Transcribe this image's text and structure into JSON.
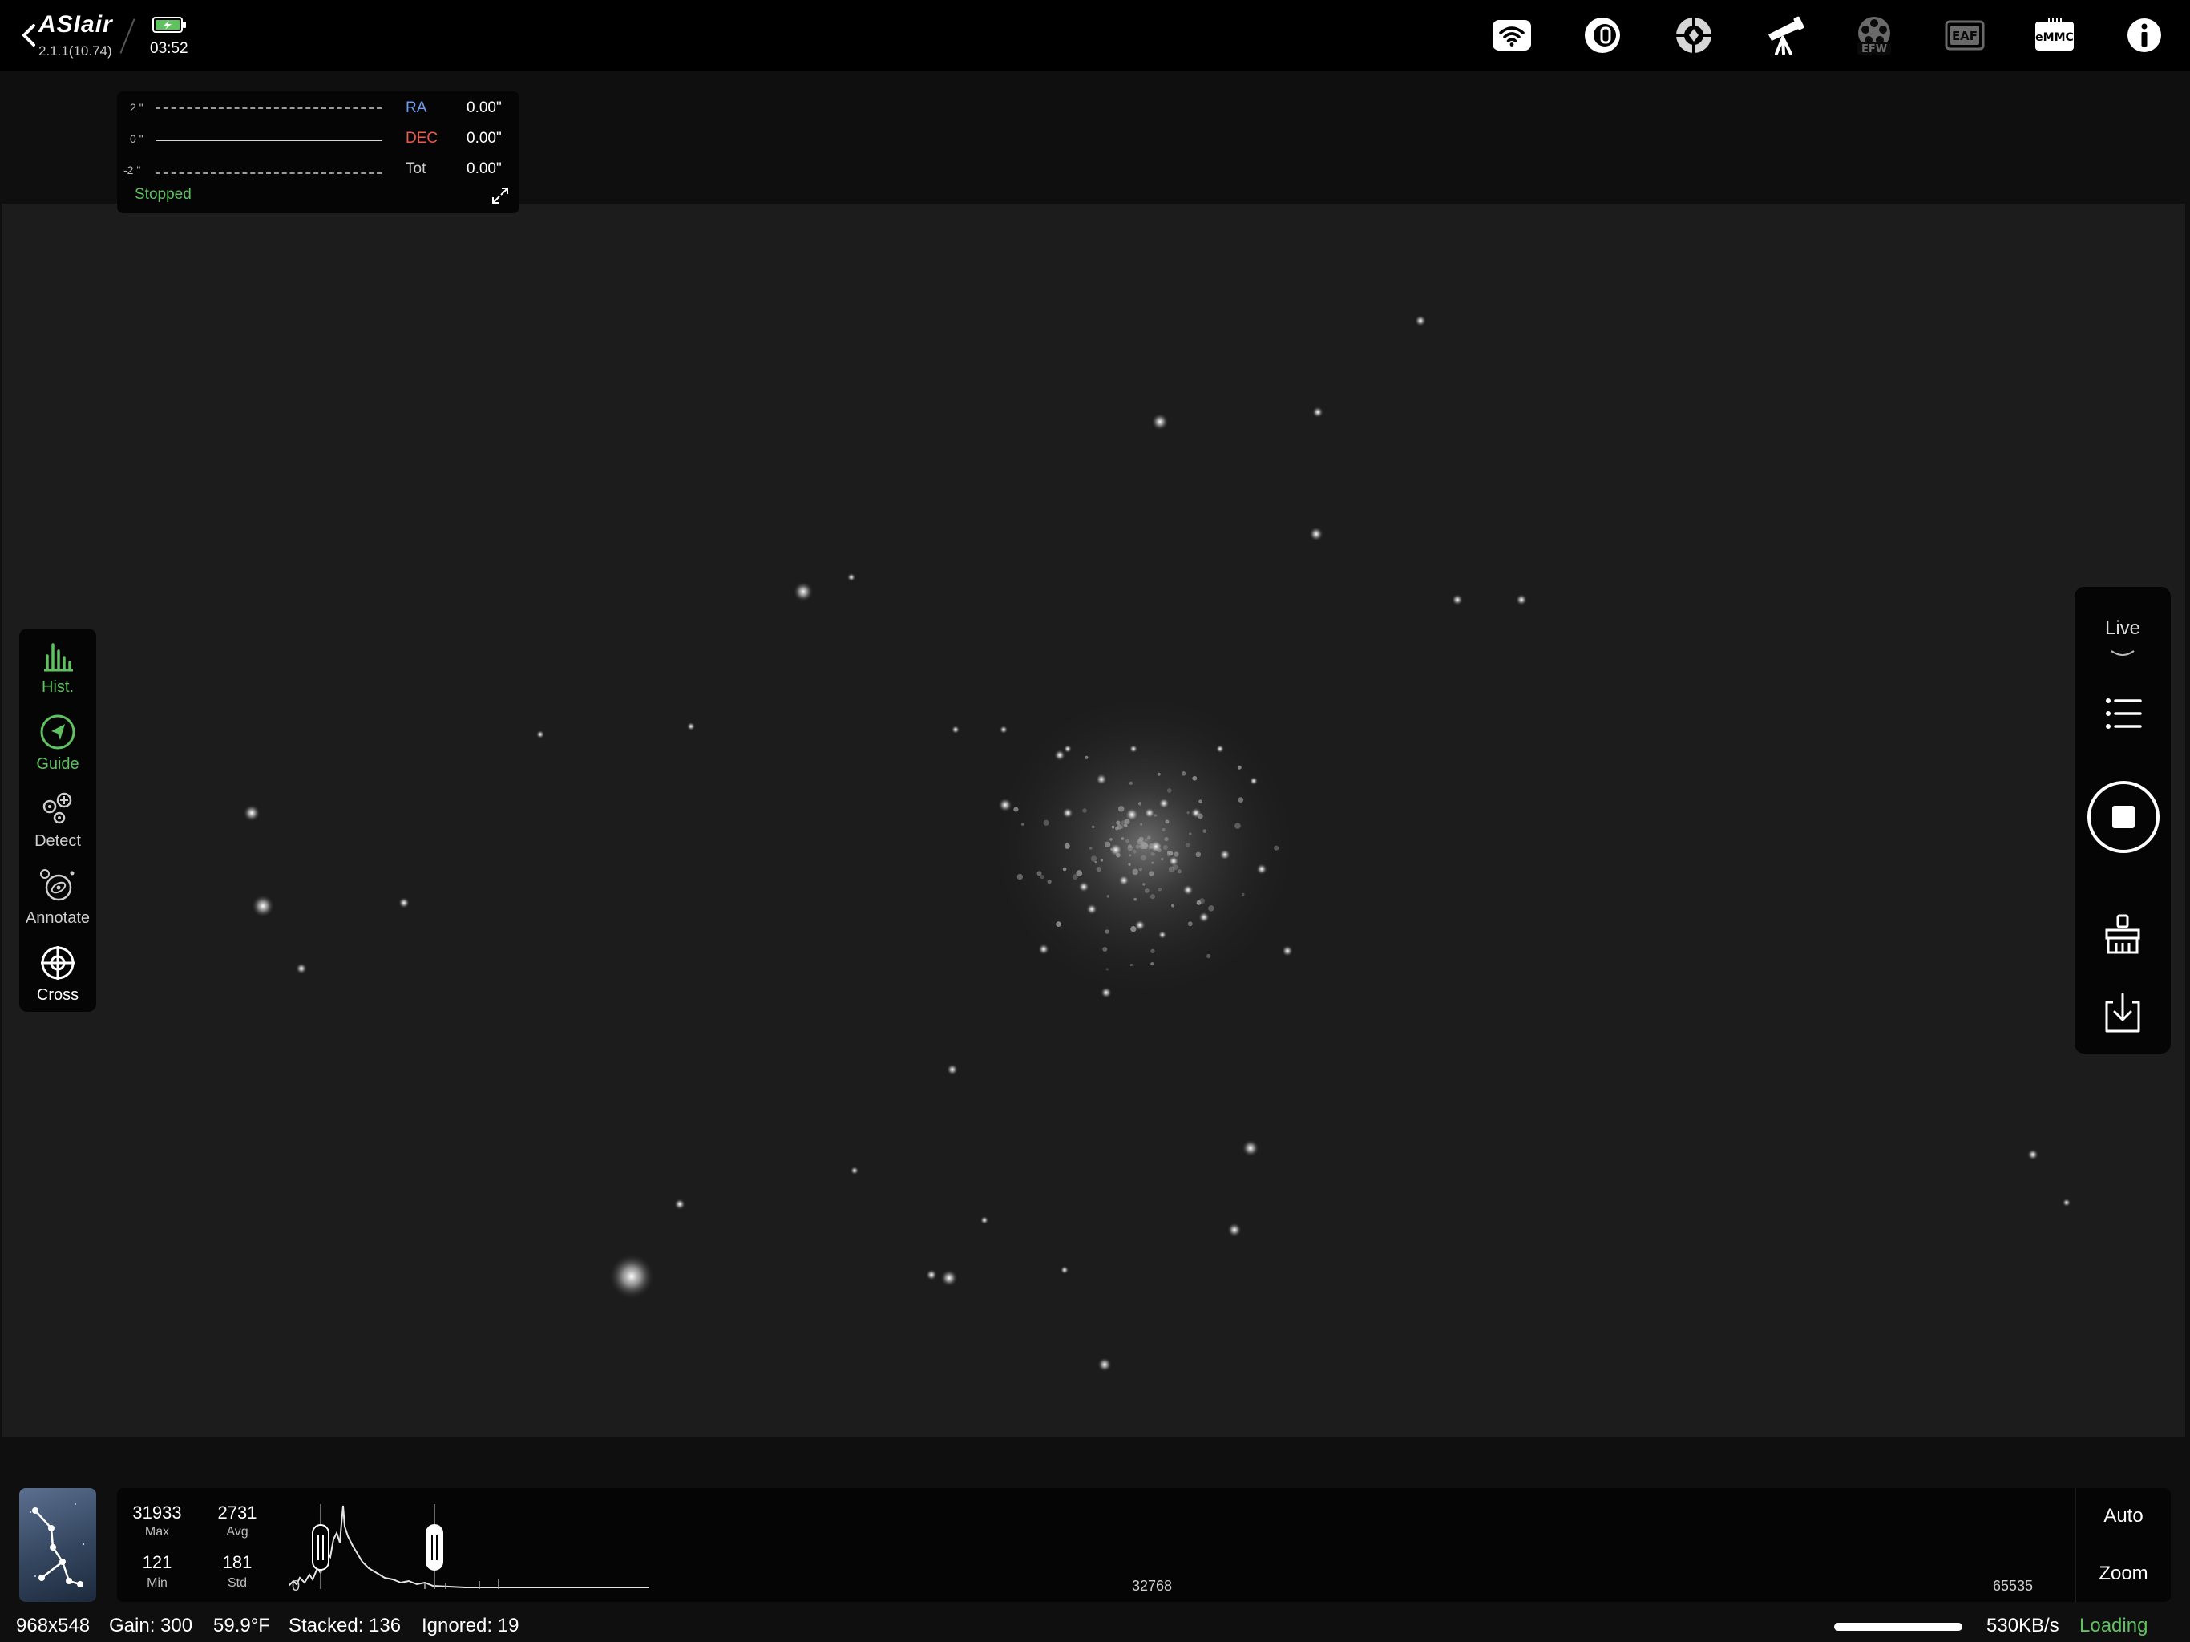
{
  "header": {
    "app_name": "ASIair",
    "version": "2.1.1(10.74)",
    "time": "03:52",
    "status_icons": [
      "wifi-icon",
      "camera-icon",
      "guide-scope-icon",
      "telescope-mount-icon",
      "efw-icon",
      "eaf-icon",
      "emmc-icon",
      "info-icon"
    ],
    "efw_label": "EFW",
    "eaf_label": "EAF",
    "emmc_label": "eMMC"
  },
  "guide_graph": {
    "ticks": [
      "2 \"",
      "0 \"",
      "-2 \""
    ],
    "ra_label": "RA",
    "ra_value": "0.00\"",
    "dec_label": "DEC",
    "dec_value": "0.00\"",
    "tot_label": "Tot",
    "tot_value": "0.00\"",
    "status": "Stopped",
    "colors": {
      "ra": "#6f9cf0",
      "dec": "#ef5a4e",
      "status": "#5fc15f"
    }
  },
  "left_tools": [
    {
      "label": "Hist.",
      "icon": "histogram-icon",
      "active": true
    },
    {
      "label": "Guide",
      "icon": "guide-icon",
      "active": true
    },
    {
      "label": "Detect",
      "icon": "detect-icon",
      "active": false
    },
    {
      "label": "Annotate",
      "icon": "annotate-icon",
      "active": false
    },
    {
      "label": "Cross",
      "icon": "crosshair-icon",
      "active": false
    }
  ],
  "right_tools": {
    "mode": "Live",
    "icons": [
      "chevron-down-icon",
      "list-icon",
      "stop-icon",
      "clear-brush-icon",
      "save-download-icon"
    ]
  },
  "histogram": {
    "max": "31933",
    "max_label": "Max",
    "avg": "2731",
    "avg_label": "Avg",
    "min": "121",
    "min_label": "Min",
    "std": "181",
    "std_label": "Std",
    "axis": [
      "0",
      "32768",
      "65535"
    ],
    "auto_label": "Auto",
    "zoom_label": "Zoom"
  },
  "status_bar": {
    "resolution": "968x548",
    "gain": "Gain: 300",
    "temperature": "59.9°F",
    "stacked": "Stacked: 136",
    "ignored": "Ignored: 19",
    "speed": "530KB/s",
    "loading": "Loading",
    "progress": 1.0
  },
  "colors": {
    "accent": "#5fc15f",
    "background": "#0f0f0f",
    "panel": "#050505"
  }
}
